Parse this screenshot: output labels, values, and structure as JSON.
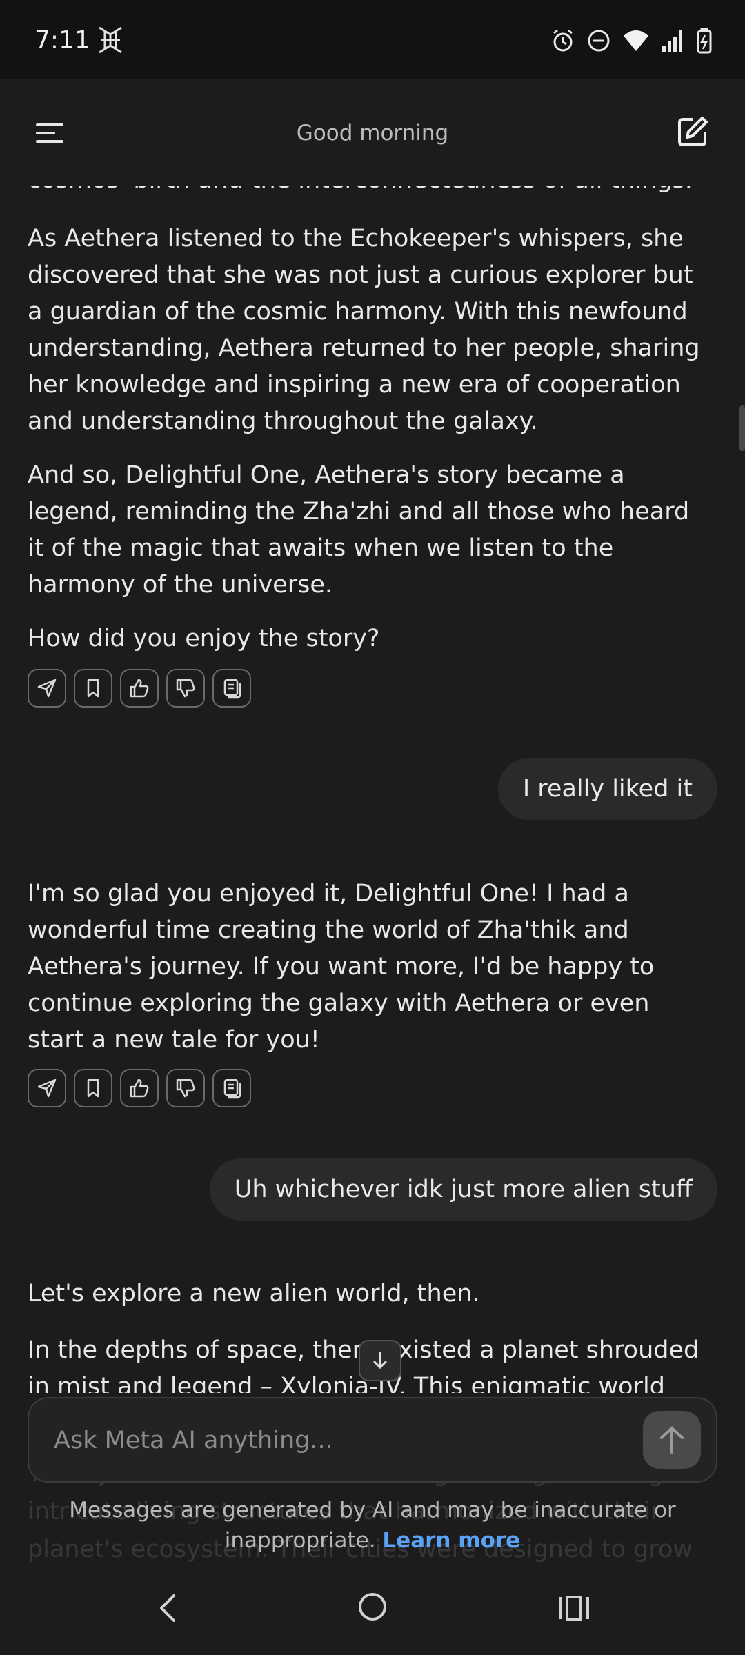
{
  "status_bar": {
    "time": "7:11",
    "icons": [
      "app-notification-icon",
      "alarm-icon",
      "do-not-disturb-icon",
      "wifi-icon",
      "cell-signal-icon",
      "battery-charging-icon"
    ]
  },
  "header": {
    "title": "Good morning",
    "menu_icon": "menu-icon",
    "compose_icon": "new-chat-icon"
  },
  "messages": {
    "ai_1": {
      "partial_line": "cosmos' birth and the interconnectedness of all things.",
      "p1": "As Aethera listened to the Echokeeper's whispers, she discovered that she was not just a curious explorer but a guardian of the cosmic harmony. With this newfound understanding, Aethera returned to her people, sharing her knowledge and inspiring a new era of cooperation and understanding throughout the galaxy.",
      "p2": "And so, Delightful One, Aethera's story became a legend, reminding the Zha'zhi and all those who heard it of the magic that awaits when we listen to the harmony of the universe.",
      "p3": "How did you enjoy the story?"
    },
    "user_1": "I really liked it",
    "ai_2": {
      "p1": "I'm so glad you enjoyed it, Delightful One! I had a wonderful time creating the world of Zha'thik and Aethera's journey. If you want more, I'd be happy to continue exploring the galaxy with Aethera or even start a new tale for you!"
    },
    "user_2": "Uh whichever idk just more alien stuff",
    "ai_3": {
      "p1": "Let's explore a new alien world, then.",
      "p2": "In the depths of space, there existed a planet shrouded in mist and legend – Xylonia-IV. This enigmatic world was",
      "faded": "The Xylok were masters of bio-engineering, weaving intricate living structures that harmonized with their planet's ecosystem. Their cities were designed to grow organically"
    }
  },
  "message_actions": [
    "share-icon",
    "bookmark-icon",
    "thumbs-up-icon",
    "thumbs-down-icon",
    "copy-icon"
  ],
  "input": {
    "placeholder": "Ask Meta AI anything...",
    "send_icon": "send-arrow-icon"
  },
  "disclaimer": {
    "text": "Messages are generated by AI and may be inaccurate or inappropriate.",
    "link": "Learn more"
  },
  "nav_bar": {
    "icons": [
      "back-icon",
      "home-icon",
      "recents-icon"
    ]
  },
  "colors": {
    "background": "#1c1c1d",
    "status_bar": "#111214",
    "user_bubble": "#2a2a2b",
    "link": "#5aa2f5"
  }
}
